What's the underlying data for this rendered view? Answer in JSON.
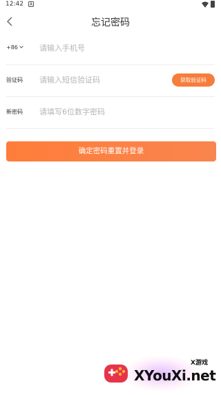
{
  "status_bar": {
    "time": "12:42",
    "notification_glyph": "A",
    "wifi_icon": "wifi-icon",
    "battery_icon": "battery-icon"
  },
  "header": {
    "title": "忘记密码",
    "back_icon": "chevron-left-icon"
  },
  "form": {
    "phone": {
      "country_code": "+86",
      "placeholder": "请输入手机号"
    },
    "code": {
      "label": "验证码",
      "placeholder": "请输入短信验证码",
      "get_code_label": "获取验证码"
    },
    "password": {
      "label": "新密码",
      "placeholder": "请填写6位数字密码"
    },
    "submit_label": "确定密码重置并登录"
  },
  "watermark": {
    "small_text": "X游戏",
    "big_text": "XYouXi.net"
  },
  "colors": {
    "accent": "#f67d3c",
    "placeholder": "#b5b5b5",
    "divider": "#ededed"
  }
}
